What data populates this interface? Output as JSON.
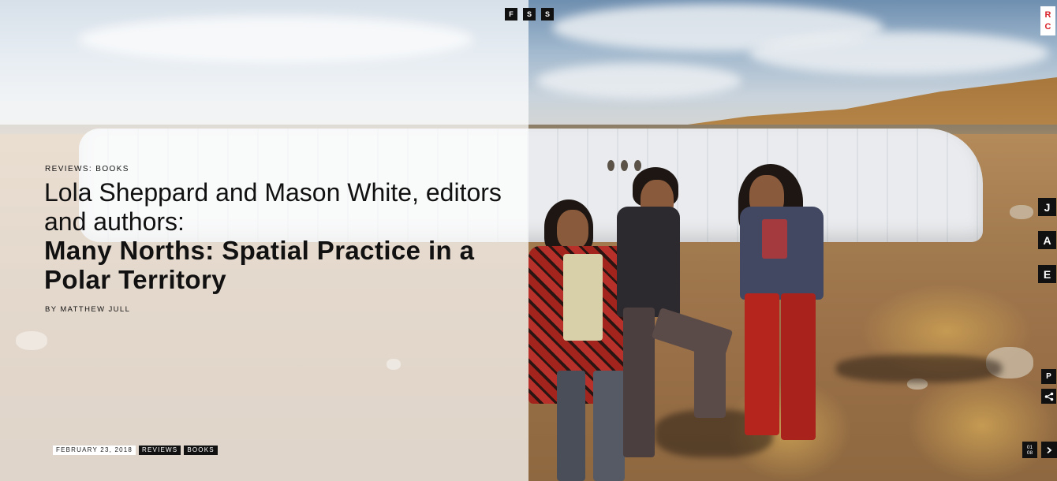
{
  "share": {
    "items": [
      {
        "label": "F",
        "icon": "facebook-icon"
      },
      {
        "label": "S",
        "icon": "share-icon"
      },
      {
        "label": "S",
        "icon": "share-icon"
      }
    ]
  },
  "logo": {
    "line1": "R",
    "line2": "C",
    "color": "#d8232a"
  },
  "article": {
    "category": "REVIEWS: BOOKS",
    "kicker": "Lola Sheppard and Mason White, editors and authors:",
    "title": "Many Norths: Spatial Practice in a Polar Territory",
    "byline": "BY MATTHEW JULL",
    "date": "FEBRUARY 23, 2018",
    "tags": [
      "REVIEWS",
      "BOOKS"
    ]
  },
  "side_nav": {
    "items": [
      "J",
      "A",
      "E"
    ],
    "print_label": "P",
    "share_icon": "share-icon"
  },
  "gallery": {
    "current": "01",
    "total": "08",
    "next_icon": "chevron-right-icon"
  }
}
